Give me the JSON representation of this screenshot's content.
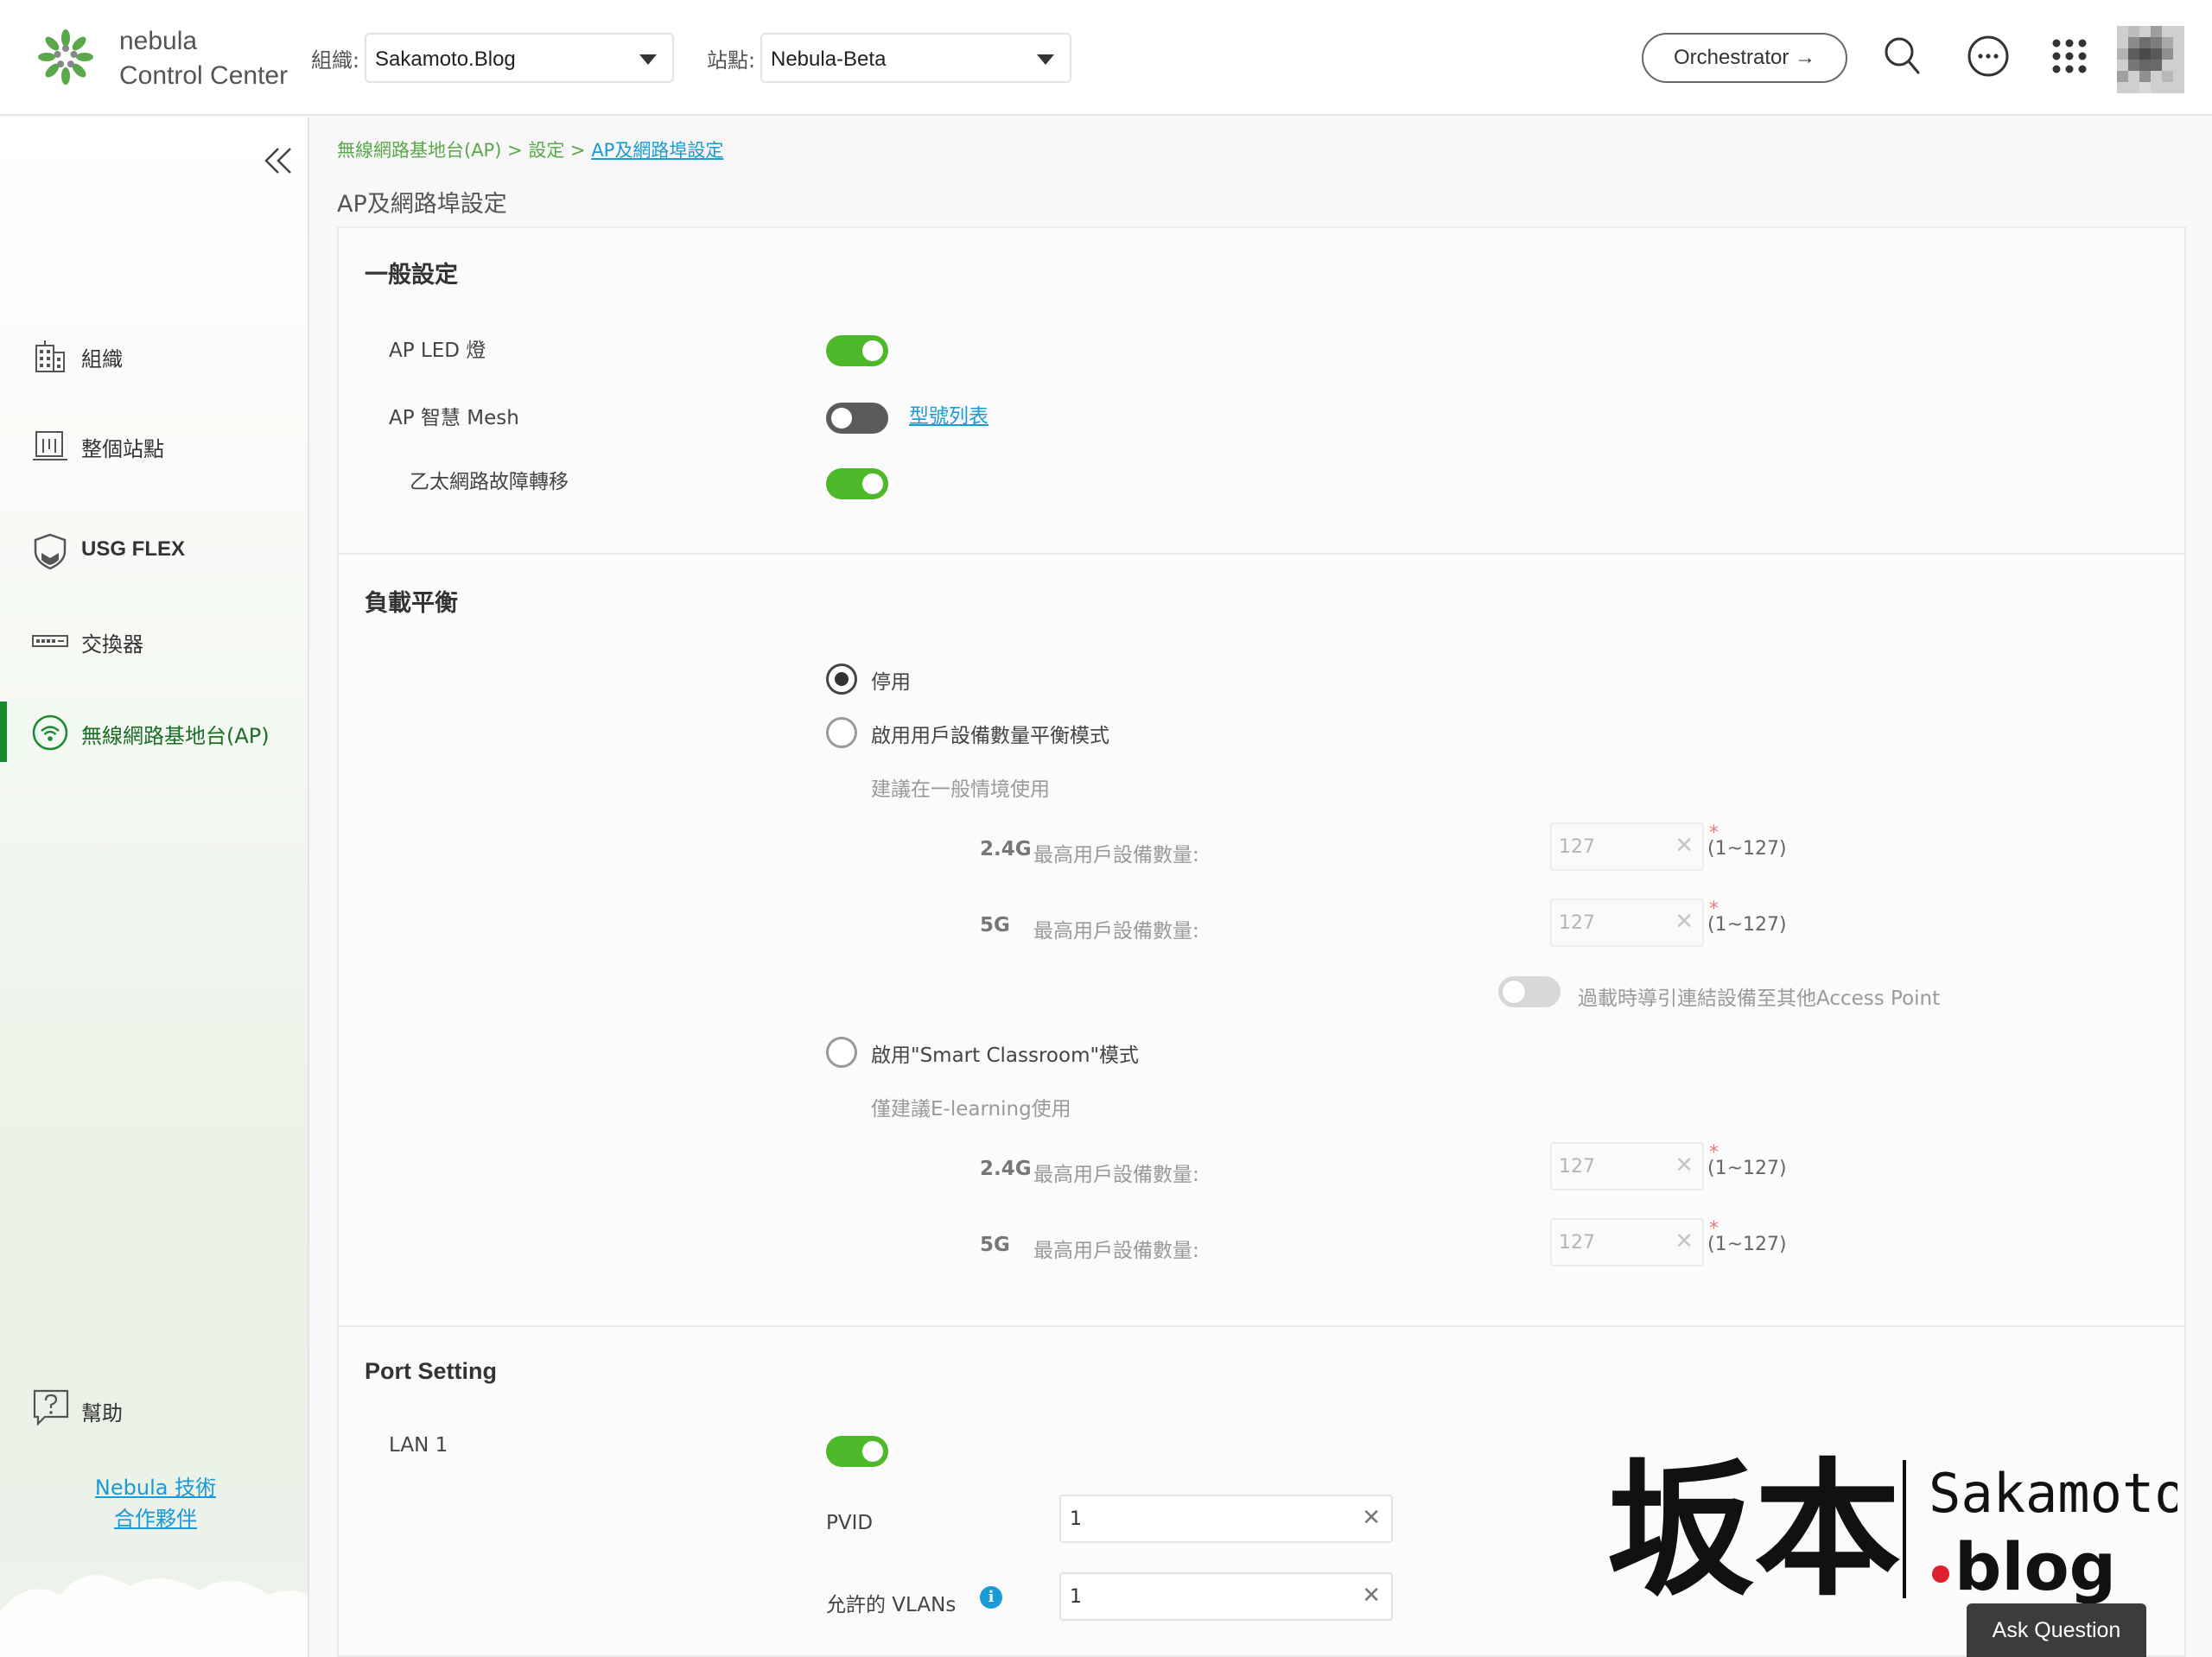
{
  "header": {
    "logo_line1": "nebula",
    "logo_line2": "Control Center",
    "org_label": "組織:",
    "org_value": "Sakamoto.Blog",
    "site_label": "站點:",
    "site_value": "Nebula-Beta",
    "orchestrator_label": "Orchestrator →",
    "icons": [
      "search-icon",
      "chat-icon",
      "apps-grid-icon",
      "avatar"
    ]
  },
  "sidebar": {
    "items": [
      {
        "label": "組織",
        "icon": "building-icon"
      },
      {
        "label": "整個站點",
        "icon": "site-icon"
      },
      {
        "label": "USG FLEX",
        "icon": "shield-icon"
      },
      {
        "label": "交換器",
        "icon": "switch-icon"
      },
      {
        "label": "無線網路基地台(AP)",
        "icon": "wifi-icon",
        "active": true
      }
    ],
    "help_label": "幫助",
    "partner_line1": "Nebula 技術",
    "partner_line2": "合作夥伴"
  },
  "breadcrumb": {
    "part1": "無線網路基地台(AP) > 設定 > ",
    "current": "AP及網路埠設定"
  },
  "page_title": "AP及網路埠設定",
  "general": {
    "title": "一般設定",
    "led_label": "AP LED 燈",
    "led_on": true,
    "mesh_label": "AP 智慧 Mesh",
    "mesh_on": false,
    "model_list_link": "型號列表",
    "failover_label": "乙太網路故障轉移",
    "failover_on": true
  },
  "load_balance": {
    "title": "負載平衡",
    "opt_disable": "停用",
    "opt_client_balance": "啟用用戶設備數量平衡模式",
    "hint_general": "建議在一般情境使用",
    "band_24": "2.4G",
    "band_5": "5G",
    "max_clients_label": "最高用戶設備數量:",
    "client_24_value": "127",
    "client_5_value": "127",
    "required_mark": "*",
    "range_text": "(1~127)",
    "steer_label": "過載時導引連結設備至其他Access Point",
    "opt_smart_classroom": "啟用\"Smart Classroom\"模式",
    "hint_elearning": "僅建議E-learning使用",
    "class_24_value": "127",
    "class_5_value": "127",
    "selected": "停用"
  },
  "port_setting": {
    "title": "Port Setting",
    "lan1_label": "LAN 1",
    "lan1_on": true,
    "pvid_label": "PVID",
    "pvid_value": "1",
    "vlans_label": "允許的 VLANs",
    "vlans_value": "1"
  },
  "watermark": {
    "kanji": "坂本",
    "line1": "Sakamoto",
    "line2": ".blog"
  },
  "ask_question_label": "Ask Question",
  "colors": {
    "accent_green": "#4cb82a",
    "link_blue": "#1a9ad6",
    "breadcrumb_green": "#5aa84a"
  }
}
